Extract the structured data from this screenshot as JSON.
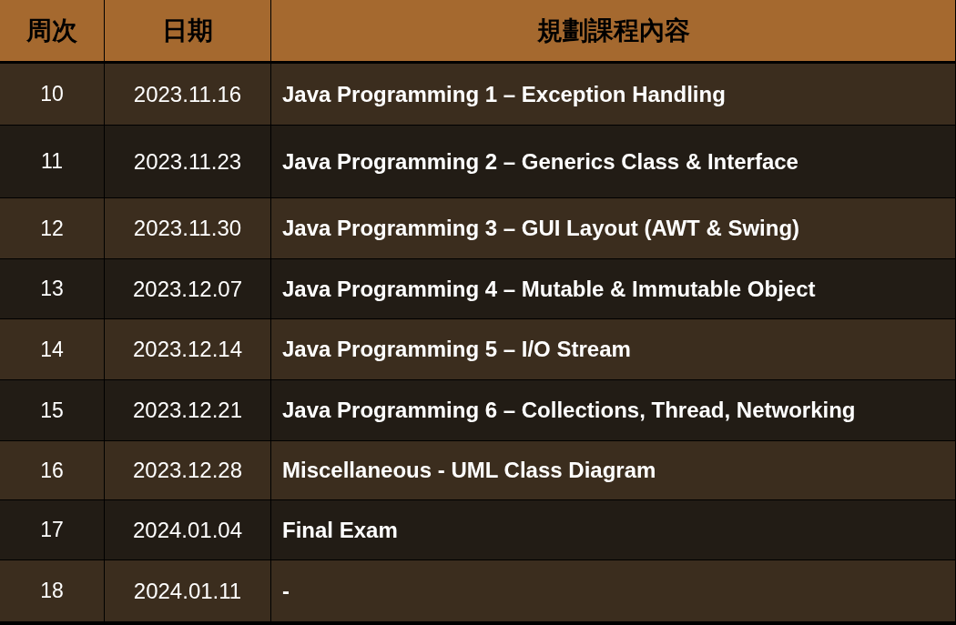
{
  "table": {
    "columns": [
      "周次",
      "日期",
      "規劃課程內容"
    ],
    "rows": [
      {
        "week": "10",
        "date": "2023.11.16",
        "content": "Java Programming 1 – Exception Handling"
      },
      {
        "week": "11",
        "date": "2023.11.23",
        "content": "Java Programming 2 – Generics Class & Interface"
      },
      {
        "week": "12",
        "date": "2023.11.30",
        "content": "Java Programming 3 – GUI Layout (AWT & Swing)"
      },
      {
        "week": "13",
        "date": "2023.12.07",
        "content": "Java Programming 4 – Mutable & Immutable Object"
      },
      {
        "week": "14",
        "date": "2023.12.14",
        "content": "Java Programming 5 – I/O Stream"
      },
      {
        "week": "15",
        "date": "2023.12.21",
        "content": "Java Programming 6 – Collections, Thread, Networking"
      },
      {
        "week": "16",
        "date": "2023.12.28",
        "content": "Miscellaneous - UML Class Diagram"
      },
      {
        "week": "17",
        "date": "2024.01.04",
        "content": "Final Exam"
      },
      {
        "week": "18",
        "date": "2024.01.11",
        "content": "-"
      }
    ]
  }
}
